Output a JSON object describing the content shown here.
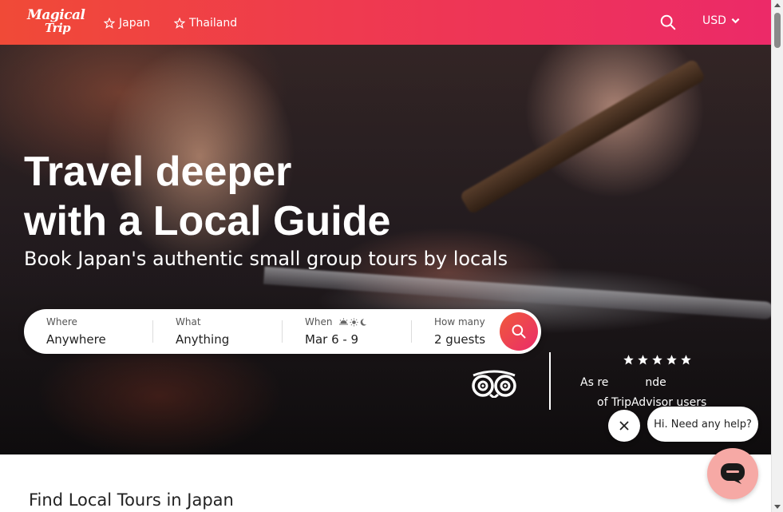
{
  "header": {
    "logo_line1": "Magical",
    "logo_line2": "Trip",
    "nav": [
      {
        "label": "Japan",
        "icon": "star-outline-icon"
      },
      {
        "label": "Thailand",
        "icon": "star-outline-icon"
      }
    ],
    "currency": "USD"
  },
  "hero": {
    "title_line1": "Travel deeper",
    "title_line2": "with a Local Guide",
    "subtitle": "Book Japan's authentic small group tours by locals"
  },
  "search": {
    "where": {
      "label": "Where",
      "value": "Anywhere"
    },
    "what": {
      "label": "What",
      "value": "Anything"
    },
    "when": {
      "label": "When",
      "value": "Mar 6 - 9",
      "icons": [
        "sunrise-icon",
        "sun-icon",
        "moon-icon"
      ]
    },
    "how_many": {
      "label": "How many",
      "value": "2 guests"
    }
  },
  "tripadvisor": {
    "rating_stars": 5,
    "text_line1": "As re",
    "text_line1_tail": "nde",
    "text_line2": "of TripAdvisor users"
  },
  "chat": {
    "bubble_text": "Hi. Need any help?"
  },
  "section": {
    "title": "Find Local Tours in Japan"
  },
  "colors": {
    "brand_gradient_start": "#f04a37",
    "brand_gradient_end": "#ec2a68",
    "chat_launcher": "#f6a9a5"
  }
}
